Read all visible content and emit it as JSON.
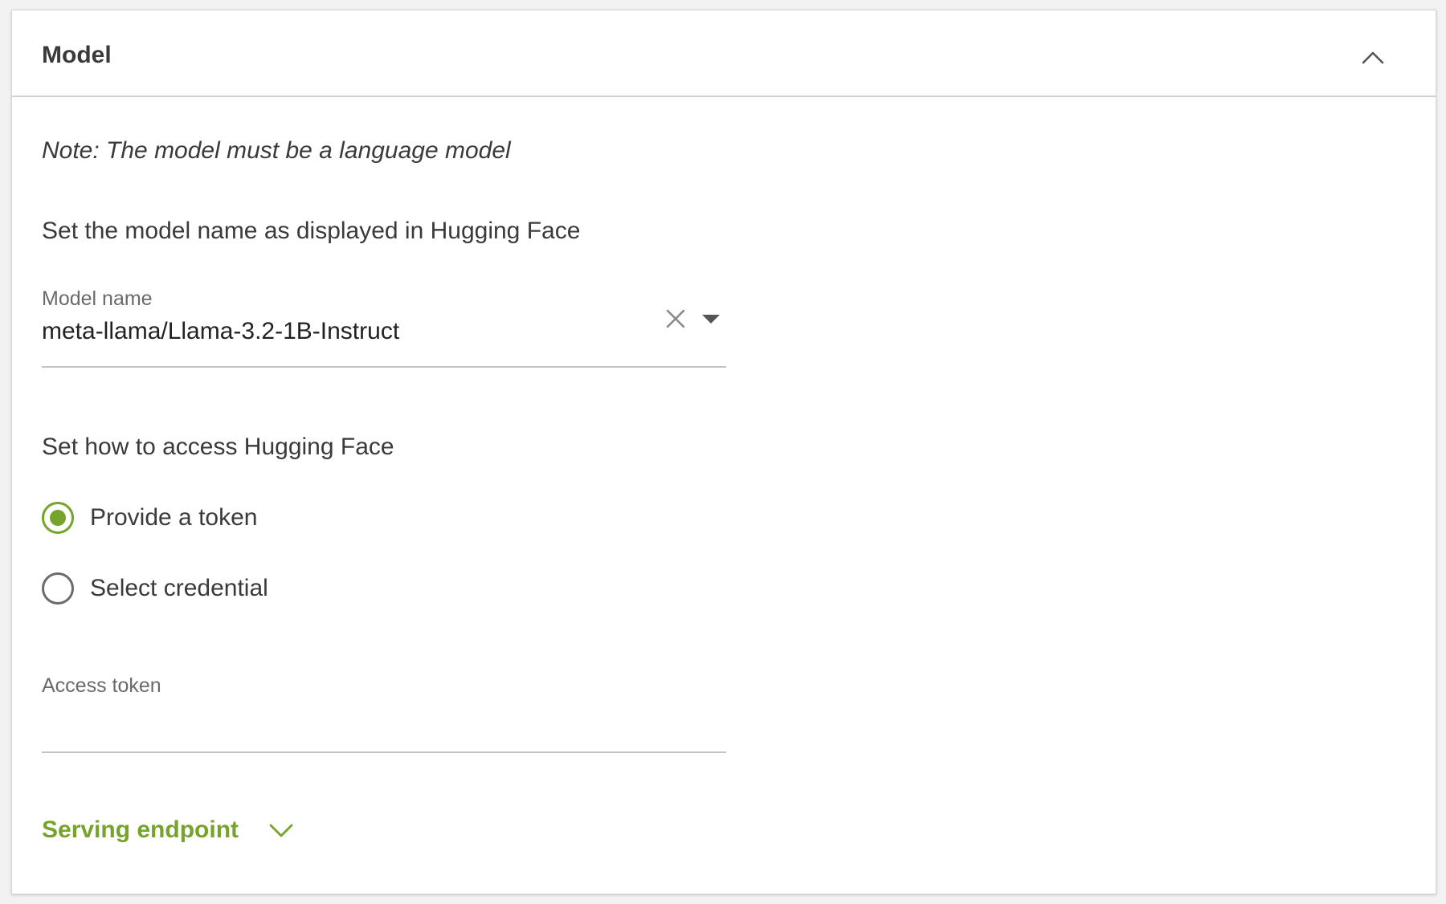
{
  "panel": {
    "title": "Model",
    "collapse_icon": "chevron-up-icon"
  },
  "note": "Note: The model must be a language model",
  "model_section": {
    "heading": "Set the model name as displayed in Hugging Face",
    "field": {
      "label": "Model name",
      "value": "meta-llama/Llama-3.2-1B-Instruct",
      "clear_icon": "close-icon",
      "dropdown_icon": "caret-down-icon"
    }
  },
  "access_section": {
    "heading": "Set how to access Hugging Face",
    "options": [
      {
        "label": "Provide a token",
        "selected": true
      },
      {
        "label": "Select credential",
        "selected": false
      }
    ],
    "token_field": {
      "label": "Access token",
      "value": ""
    }
  },
  "serving_endpoint": {
    "label": "Serving endpoint",
    "icon": "chevron-down-icon"
  },
  "colors": {
    "accent": "#76a32a",
    "text": "#3a3a3a",
    "divider": "#cfcfcf"
  }
}
